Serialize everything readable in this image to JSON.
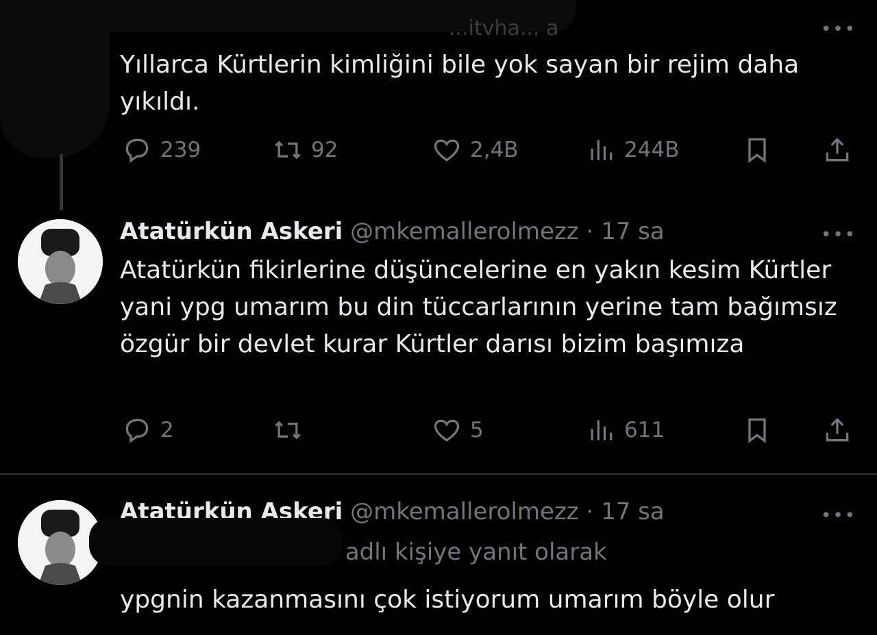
{
  "tweets": [
    {
      "text": "Yıllarca Kürtlerin kimliğini bile yok sayan bir rejim daha yıkıldı.",
      "header_partial": "...itvha... a",
      "replies": "239",
      "retweets": "92",
      "likes": "2,4B",
      "views": "244B"
    },
    {
      "name": "Atatürkün Askeri",
      "handle": "@mkemallerolmezz",
      "time": "· 17 sa",
      "text": "Atatürkün fikirlerine düşüncelerine en yakın kesim Kürtler yani ypg umarım bu din tüccarlarının yerine tam bağımsız özgür bir devlet kurar Kürtler darısı bizim başımıza",
      "replies": "2",
      "retweets": "",
      "likes": "5",
      "views": "611"
    },
    {
      "name": "Atatürkün Askeri",
      "handle": "@mkemallerolmezz",
      "time": "· 17 sa",
      "reply_to_suffix": "adlı kişiye yanıt olarak",
      "text": "ypgnin kazanmasını çok istiyorum umarım böyle olur"
    }
  ],
  "more_glyph": "•••",
  "colors": {
    "background": "#000000",
    "text": "#e7e9ea",
    "muted": "#71767b",
    "accent": "#1d9bf0"
  }
}
